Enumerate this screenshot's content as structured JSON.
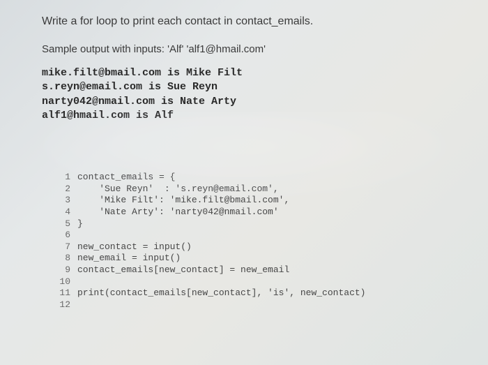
{
  "prompt": "Write a for loop to print each contact in contact_emails.",
  "sample_label": "Sample output with inputs: 'Alf' 'alf1@hmail.com'",
  "output": [
    "mike.filt@bmail.com is Mike Filt",
    "s.reyn@email.com is Sue Reyn",
    "narty042@nmail.com is Nate Arty",
    "alf1@hmail.com is Alf"
  ],
  "code": [
    {
      "n": "1",
      "t": "contact_emails = {"
    },
    {
      "n": "2",
      "t": "    'Sue Reyn'  : 's.reyn@email.com',"
    },
    {
      "n": "3",
      "t": "    'Mike Filt': 'mike.filt@bmail.com',"
    },
    {
      "n": "4",
      "t": "    'Nate Arty': 'narty042@nmail.com'"
    },
    {
      "n": "5",
      "t": "}"
    },
    {
      "n": "6",
      "t": ""
    },
    {
      "n": "7",
      "t": "new_contact = input()"
    },
    {
      "n": "8",
      "t": "new_email = input()"
    },
    {
      "n": "9",
      "t": "contact_emails[new_contact] = new_email"
    },
    {
      "n": "10",
      "t": ""
    },
    {
      "n": "11",
      "t": "print(contact_emails[new_contact], 'is', new_contact)"
    },
    {
      "n": "12",
      "t": ""
    }
  ]
}
